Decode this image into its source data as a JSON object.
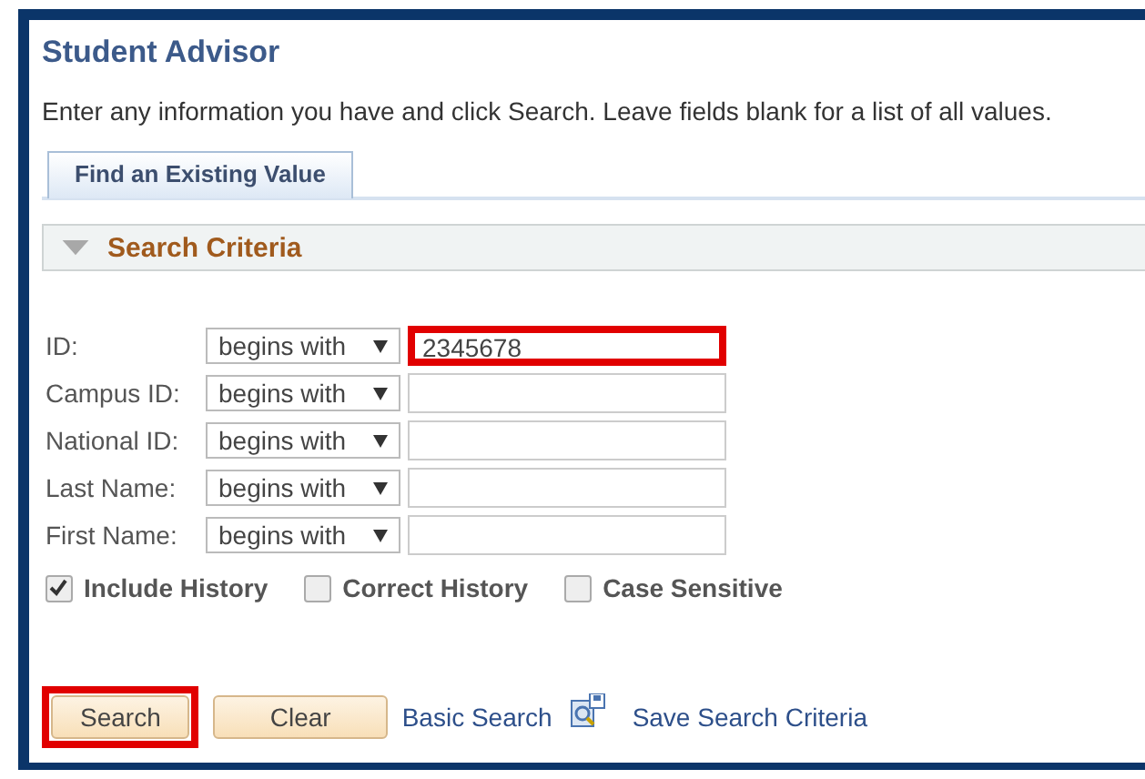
{
  "page": {
    "title": "Student Advisor",
    "instructions": "Enter any information you have and click Search. Leave fields blank for a list of all values."
  },
  "tabs": [
    {
      "label": "Find an Existing Value",
      "selected": true
    }
  ],
  "section": {
    "title": "Search Criteria",
    "expanded": true
  },
  "fields": [
    {
      "label": "ID:",
      "operator": "begins with",
      "value": "2345678",
      "highlighted": true
    },
    {
      "label": "Campus ID:",
      "operator": "begins with",
      "highlighted": false
    },
    {
      "label": "National ID:",
      "operator": "begins with",
      "highlighted": false
    },
    {
      "label": "Last Name:",
      "operator": "begins with",
      "highlighted": false
    },
    {
      "label": "First Name:",
      "operator": "begins with",
      "highlighted": false
    }
  ],
  "options": [
    {
      "label": "Include History",
      "checked": true
    },
    {
      "label": "Correct History",
      "checked": false
    },
    {
      "label": "Case Sensitive",
      "checked": false
    }
  ],
  "buttons": [
    {
      "label": "Search",
      "highlighted": true
    },
    {
      "label": "Clear",
      "highlighted": false
    }
  ],
  "links": {
    "basic_search": "Basic Search",
    "save_criteria": "Save Search Criteria"
  }
}
